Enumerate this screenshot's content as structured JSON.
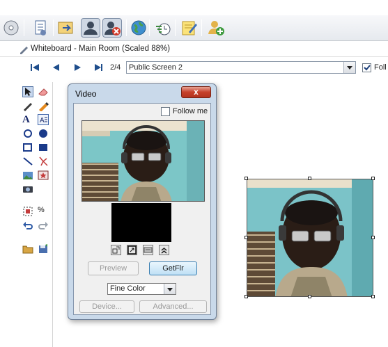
{
  "whiteboard": {
    "title": "Whiteboard - Main Room (Scaled 88%)",
    "page_indicator": "2/4",
    "screen_select_value": "Public Screen 2",
    "follow_label_truncated": "Foll"
  },
  "video_window": {
    "title": "Video",
    "close_label": "x",
    "follow_me_label": "Follow me",
    "preview_label": "Preview",
    "getfir_label": "GetFlr",
    "color_select_value": "Fine Color",
    "device_label": "Device...",
    "advanced_label": "Advanced..."
  },
  "toolbar_icons": [
    "disc-icon",
    "document-icon",
    "forward-icon",
    "user-icon",
    "user-remove-icon",
    "globe-icon",
    "clock-icon",
    "notes-icon",
    "add-user-icon"
  ],
  "tool_icons": [
    "arrow-icon",
    "eraser-icon",
    "pen-icon",
    "marker-icon",
    "text-icon",
    "text-box-icon",
    "circle-outline-icon",
    "circle-filled-icon",
    "rectangle-outline-icon",
    "rectangle-filled-icon",
    "line-icon",
    "star-burst-icon",
    "image-icon",
    "image-star-icon",
    "camera-icon",
    "select-region-icon",
    "percent-icon",
    "undo-icon",
    "redo-icon",
    "folder-icon",
    "save-icon"
  ],
  "colors": {
    "accent": "#3c7fb1",
    "close_button": "#c6402a",
    "window_frame": "#c9d9ea"
  }
}
